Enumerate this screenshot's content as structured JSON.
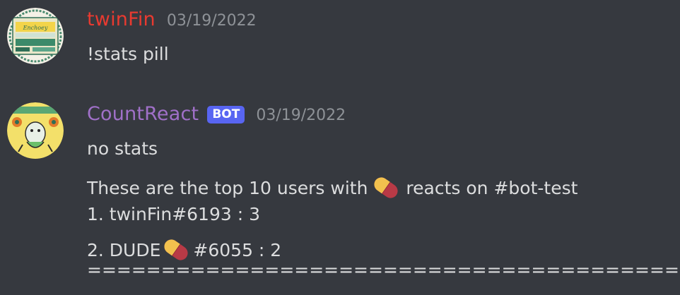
{
  "messages": [
    {
      "username": "twinFin",
      "timestamp": "03/19/2022",
      "avatar_icon": "enchanted-logo-avatar",
      "lines": [
        "!stats pill"
      ]
    },
    {
      "username": "CountReact",
      "bot_tag": "BOT",
      "timestamp": "03/19/2022",
      "avatar_icon": "cat-fish-avatar",
      "lines": {
        "l1": "no stats",
        "l2_before": "These are the top 10 users with",
        "l2_after": "reacts on #bot-test",
        "l3": "1. twinFin#6193 : 3",
        "l4_before": "2. DUDE",
        "l4_after": "#6055 : 2",
        "l5": "=========================================="
      }
    }
  ],
  "colors": {
    "background": "#36393f",
    "username_1": "#e83a30",
    "username_2": "#a070c8",
    "bot_tag_bg": "#5865f2",
    "text": "#dcddde",
    "timestamp": "#8e9297"
  },
  "emoji": "pill-emoji"
}
